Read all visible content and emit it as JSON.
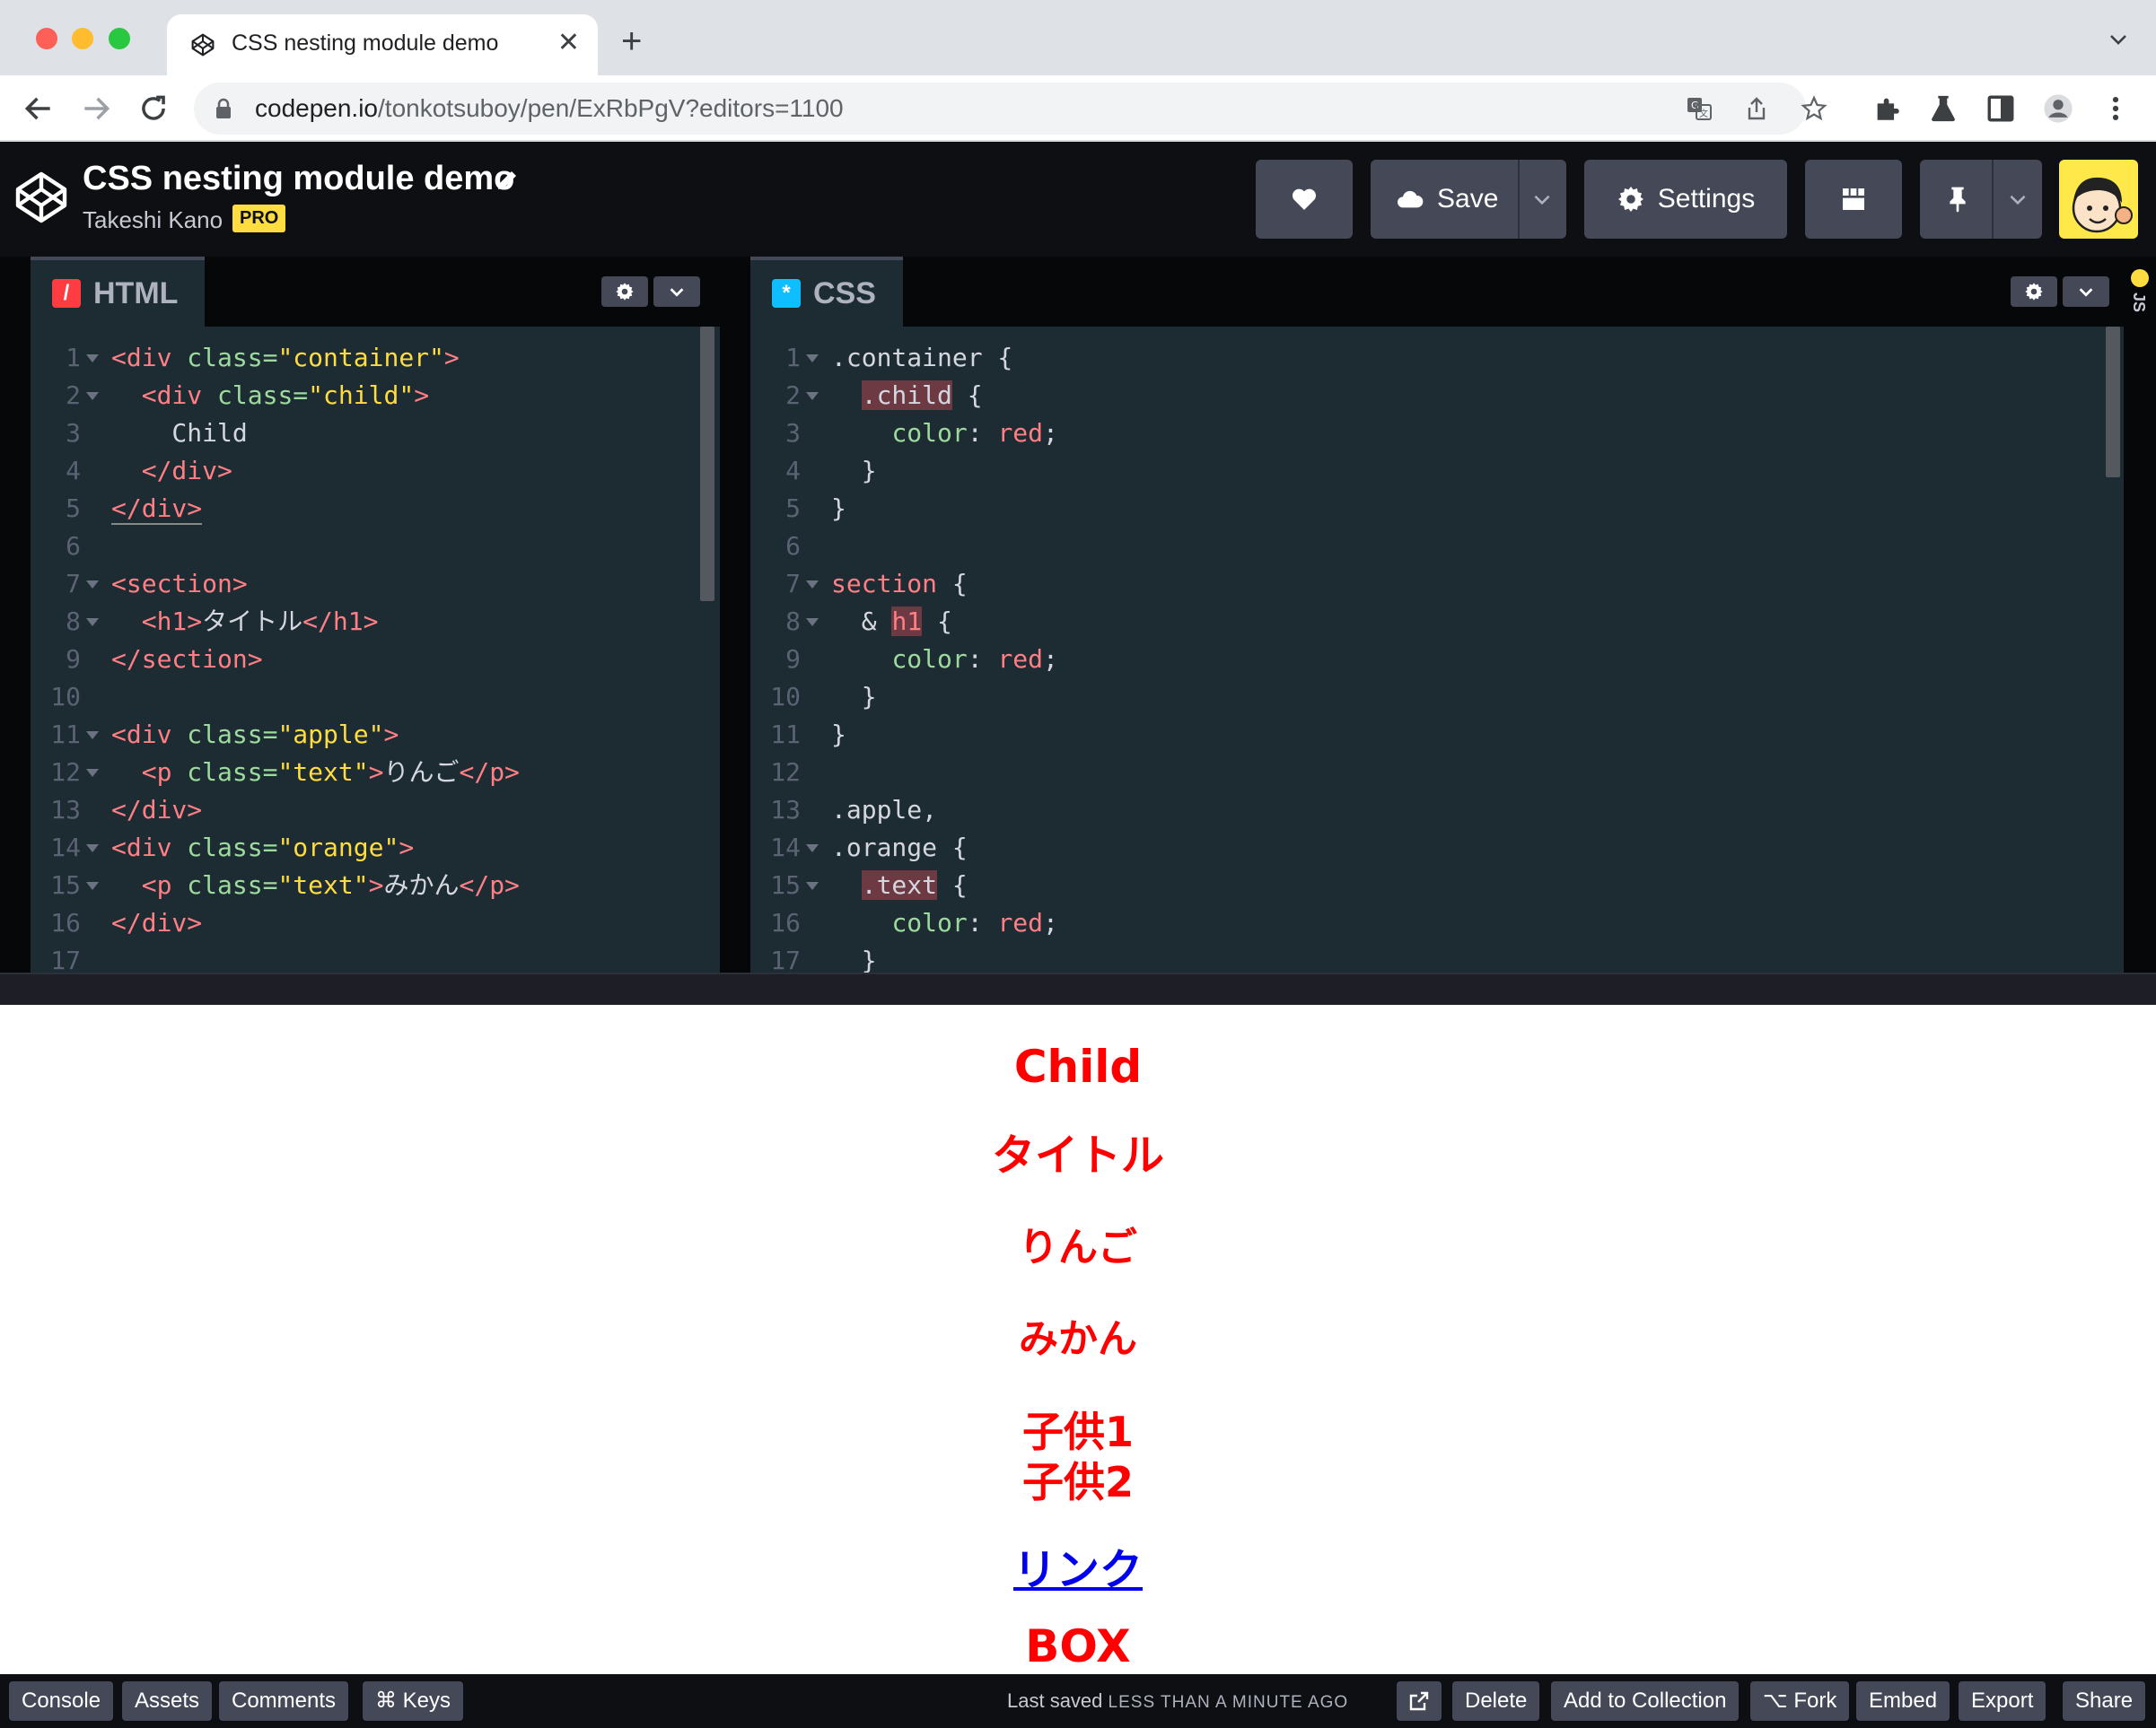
{
  "browser": {
    "tab_title": "CSS nesting module demo",
    "tab_close": "✕",
    "new_tab": "+",
    "url_host": "codepen.io",
    "url_path": "/tonkotsuboy/pen/ExRbPgV?editors=1100"
  },
  "pen": {
    "title": "CSS nesting module demo",
    "author": "Takeshi Kano",
    "badge": "PRO"
  },
  "header_buttons": {
    "save": "Save",
    "settings": "Settings"
  },
  "html_editor": {
    "label": "HTML",
    "badge": "/",
    "color": "#ff3c41",
    "lines": [
      {
        "n": "1",
        "fold": true,
        "html": "<span class='tag'>&lt;div</span> <span class='attr'>class=</span><span class='str'>\"container\"</span><span class='tag'>&gt;</span>"
      },
      {
        "n": "2",
        "fold": true,
        "html": "  <span class='tag'>&lt;div</span> <span class='attr'>class=</span><span class='str'>\"child\"</span><span class='tag'>&gt;</span>"
      },
      {
        "n": "3",
        "fold": false,
        "html": "    Child"
      },
      {
        "n": "4",
        "fold": false,
        "html": "  <span class='tag'>&lt;/div&gt;</span>"
      },
      {
        "n": "5",
        "fold": false,
        "html": "<span class='tag' style='border-bottom:2px solid #888'>&lt;/div&gt;</span>"
      },
      {
        "n": "6",
        "fold": false,
        "html": ""
      },
      {
        "n": "7",
        "fold": true,
        "html": "<span class='tag'>&lt;section&gt;</span>"
      },
      {
        "n": "8",
        "fold": true,
        "html": "  <span class='tag'>&lt;h1&gt;</span>タイトル<span class='tag'>&lt;/h1&gt;</span>"
      },
      {
        "n": "9",
        "fold": false,
        "html": "<span class='tag'>&lt;/section&gt;</span>"
      },
      {
        "n": "10",
        "fold": false,
        "html": ""
      },
      {
        "n": "11",
        "fold": true,
        "html": "<span class='tag'>&lt;div</span> <span class='attr'>class=</span><span class='str'>\"apple\"</span><span class='tag'>&gt;</span>"
      },
      {
        "n": "12",
        "fold": true,
        "html": "  <span class='tag'>&lt;p</span> <span class='attr'>class=</span><span class='str'>\"text\"</span><span class='tag'>&gt;</span>りんご<span class='tag'>&lt;/p&gt;</span>"
      },
      {
        "n": "13",
        "fold": false,
        "html": "<span class='tag'>&lt;/div&gt;</span>"
      },
      {
        "n": "14",
        "fold": true,
        "html": "<span class='tag'>&lt;div</span> <span class='attr'>class=</span><span class='str'>\"orange\"</span><span class='tag'>&gt;</span>"
      },
      {
        "n": "15",
        "fold": true,
        "html": "  <span class='tag'>&lt;p</span> <span class='attr'>class=</span><span class='str'>\"text\"</span><span class='tag'>&gt;</span>みかん<span class='tag'>&lt;/p&gt;</span>"
      },
      {
        "n": "16",
        "fold": false,
        "html": "<span class='tag'>&lt;/div&gt;</span>"
      },
      {
        "n": "17",
        "fold": false,
        "html": ""
      }
    ]
  },
  "css_editor": {
    "label": "CSS",
    "badge": "*",
    "color": "#0ebeff",
    "lines": [
      {
        "n": "1",
        "fold": true,
        "html": ".container {"
      },
      {
        "n": "2",
        "fold": true,
        "html": "  <span class='hl'>.child</span> {"
      },
      {
        "n": "3",
        "fold": false,
        "html": "    <span class='prop'>color</span>: <span class='val'>red</span>;"
      },
      {
        "n": "4",
        "fold": false,
        "html": "  }"
      },
      {
        "n": "5",
        "fold": false,
        "html": "}"
      },
      {
        "n": "6",
        "fold": false,
        "html": ""
      },
      {
        "n": "7",
        "fold": true,
        "html": "<span class='tag'>section</span> {"
      },
      {
        "n": "8",
        "fold": true,
        "html": "  &amp; <span class='hl tag'>h1</span> {"
      },
      {
        "n": "9",
        "fold": false,
        "html": "    <span class='prop'>color</span>: <span class='val'>red</span>;"
      },
      {
        "n": "10",
        "fold": false,
        "html": "  }"
      },
      {
        "n": "11",
        "fold": false,
        "html": "}"
      },
      {
        "n": "12",
        "fold": false,
        "html": ""
      },
      {
        "n": "13",
        "fold": false,
        "html": ".apple,"
      },
      {
        "n": "14",
        "fold": true,
        "html": ".orange {"
      },
      {
        "n": "15",
        "fold": true,
        "html": "  <span class='hl'>.text</span> {"
      },
      {
        "n": "16",
        "fold": false,
        "html": "    <span class='prop'>color</span>: <span class='val'>red</span>;"
      },
      {
        "n": "17",
        "fold": false,
        "html": "  }"
      }
    ]
  },
  "side_panel": {
    "label": "JS"
  },
  "preview": {
    "child": "Child",
    "title": "タイトル",
    "apple": "りんご",
    "orange": "みかん",
    "kodomo1": "子供1",
    "kodomo2": "子供2",
    "link": "リンク",
    "box": "BOX"
  },
  "footer": {
    "console": "Console",
    "assets": "Assets",
    "comments": "Comments",
    "keys": "⌘ Keys",
    "last_saved": "Last saved",
    "ago": "LESS THAN A MINUTE AGO",
    "delete": "Delete",
    "add_collection": "Add to Collection",
    "fork": "⌥ Fork",
    "embed": "Embed",
    "export": "Export",
    "share": "Share"
  }
}
